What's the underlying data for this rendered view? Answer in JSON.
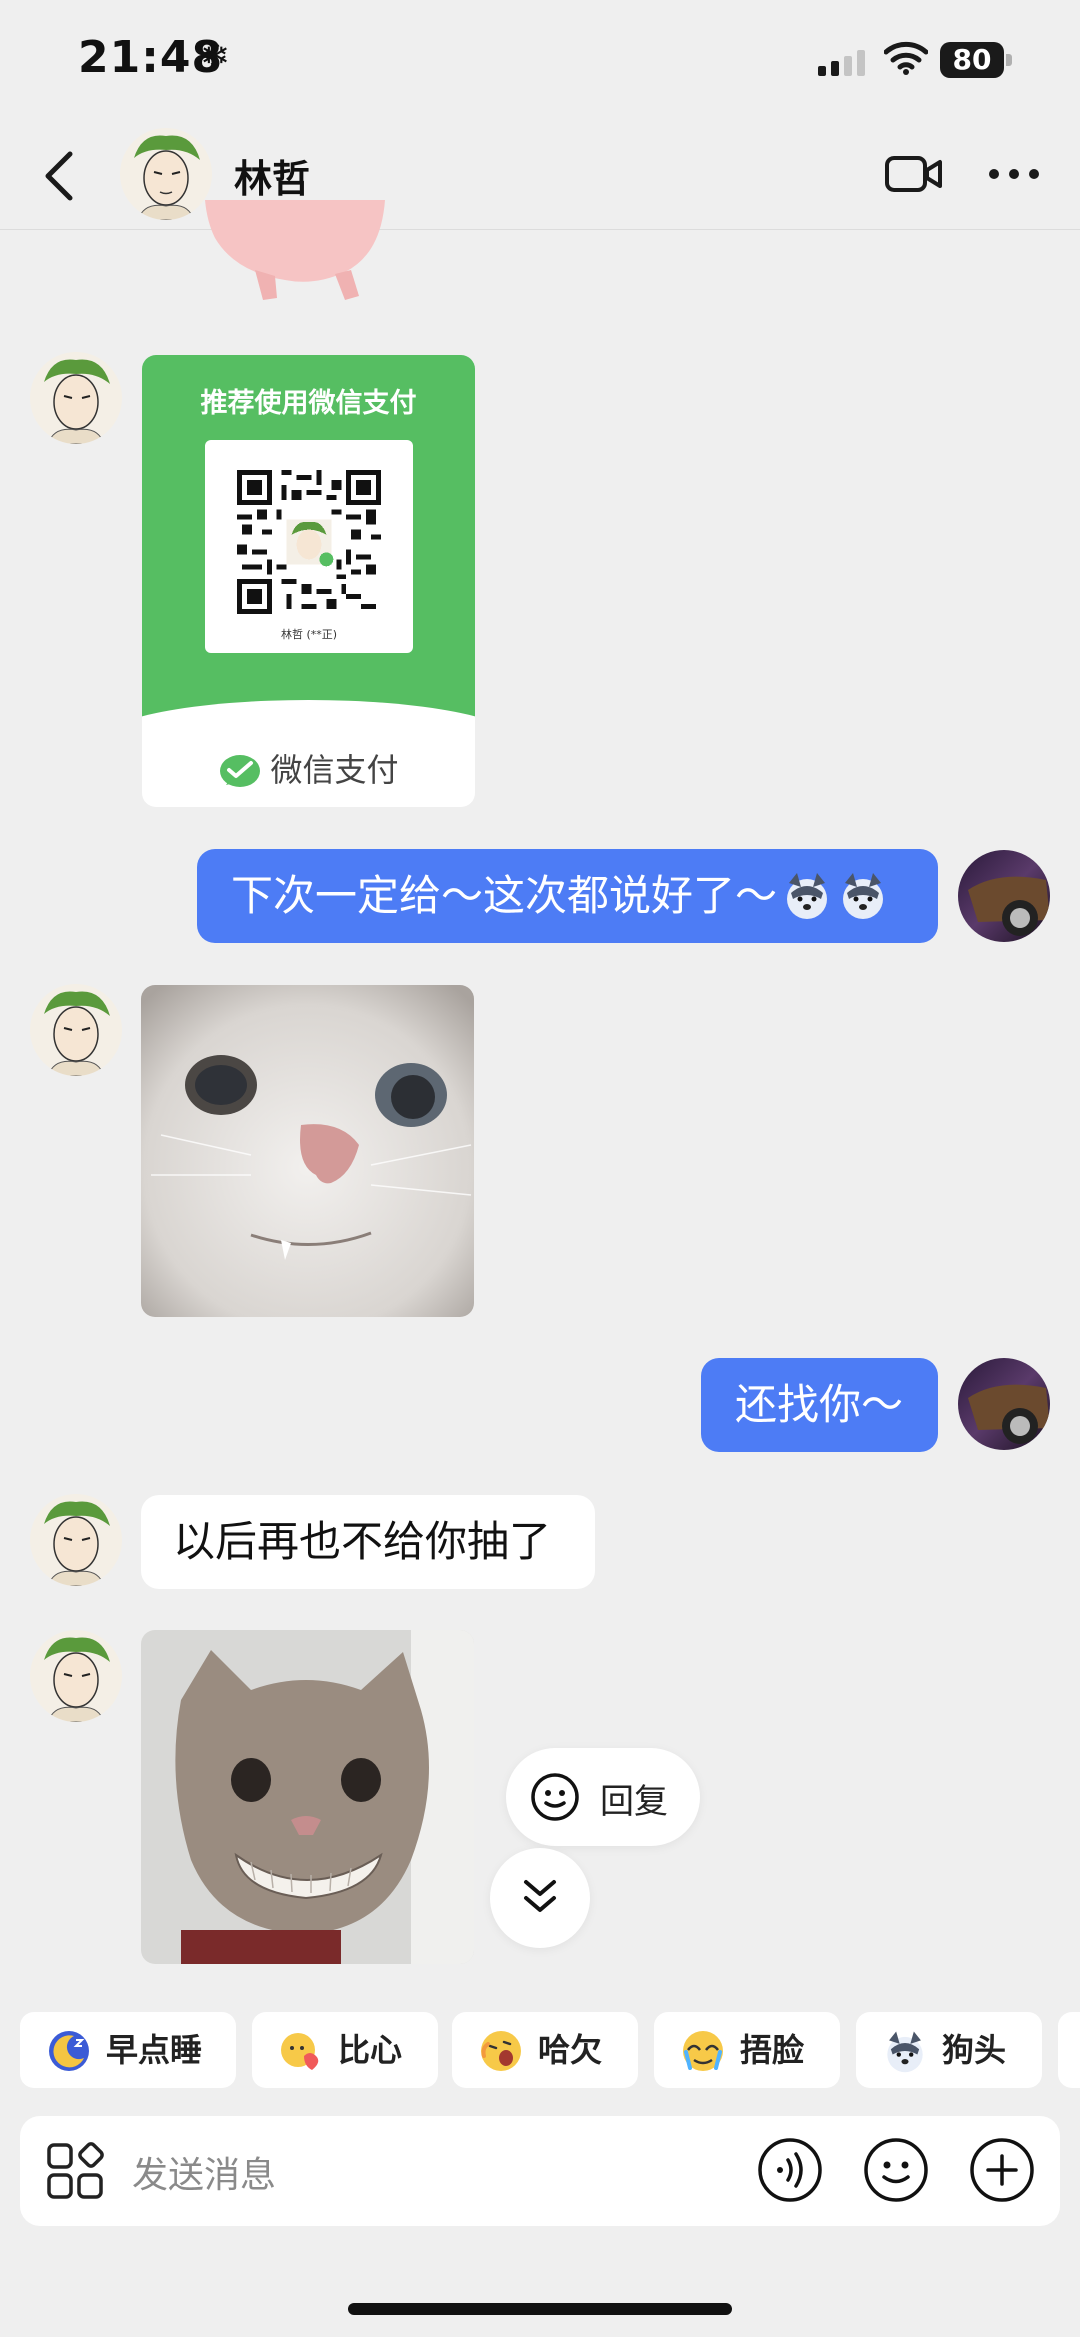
{
  "status_bar": {
    "time": "21:48",
    "weather_icon": "snowflake-icon",
    "battery": "80"
  },
  "header": {
    "contact_name": "林哲",
    "back_icon": "chevron-left-icon",
    "video_icon": "video-camera-icon",
    "more_icon": "more-dots-icon"
  },
  "messages": [
    {
      "from": "contact",
      "type": "qr_card",
      "heading": "推荐使用微信支付",
      "qr_owner": "林哲 (**正)",
      "footer": "微信支付"
    },
    {
      "from": "me",
      "type": "text",
      "text": "下次一定给～这次都说好了～",
      "emoji": [
        "dog-head-emoji",
        "dog-head-emoji"
      ]
    },
    {
      "from": "contact",
      "type": "image",
      "description_icon": "cat-sticker-image"
    },
    {
      "from": "me",
      "type": "text",
      "text": "还找你～"
    },
    {
      "from": "contact",
      "type": "text",
      "text": "以后再也不给你抽了"
    },
    {
      "from": "contact",
      "type": "image",
      "description_icon": "grinning-cat-sticker-image"
    }
  ],
  "floating": {
    "reply_label": "回复",
    "reply_icon": "smiley-icon",
    "scroll_icon": "double-chevron-down-icon"
  },
  "quick_replies": [
    {
      "label": "早点睡",
      "icon": "moon-sleep-emoji"
    },
    {
      "label": "比心",
      "icon": "heart-hands-emoji"
    },
    {
      "label": "哈欠",
      "icon": "yawn-emoji"
    },
    {
      "label": "捂脸",
      "icon": "facepalm-emoji"
    },
    {
      "label": "狗头",
      "icon": "dog-head-emoji"
    }
  ],
  "input": {
    "placeholder": "发送消息"
  },
  "colors": {
    "bubble_me": "#4d7cf5",
    "wechat_green": "#56be62",
    "background": "#efefef"
  }
}
